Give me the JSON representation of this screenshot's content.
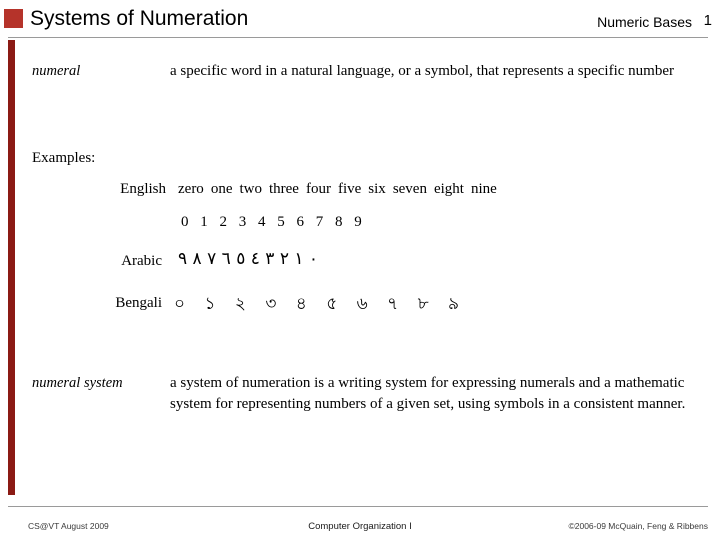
{
  "header": {
    "title": "Systems of Numeration",
    "section": "Numeric Bases",
    "page": "1"
  },
  "body": {
    "entry1": {
      "term": "numeral",
      "definition": "a specific word in a natural language, or a symbol, that represents a specific number"
    },
    "examples_label": "Examples:",
    "english_label": "English",
    "english_words": [
      "zero",
      "one",
      "two",
      "three",
      "four",
      "five",
      "six",
      "seven",
      "eight",
      "nine"
    ],
    "english_digits": "0 1 2 3 4 5 6 7 8 9",
    "arabic_label": "Arabic",
    "arabic_digits": "٠ ١ ٢ ٣ ٤ ٥ ٦ ٧ ٨ ٩",
    "bengali_label": "Bengali",
    "bengali_digits": "০ ১ ২ ৩ ৪ ৫ ৬ ৭ ৮ ৯",
    "entry2": {
      "term": "numeral system",
      "definition": "a system of numeration is a writing system for expressing numerals and a mathematic system for representing numbers of a given set, using symbols in a consistent manner."
    }
  },
  "footer": {
    "left": "CS@VT August 2009",
    "center": "Computer Organization I",
    "right": "©2006-09 McQuain, Feng & Ribbens"
  },
  "colors": {
    "header_square": "#b5332a",
    "left_bar": "#8b1a14",
    "rule": "#9a9a9a"
  }
}
